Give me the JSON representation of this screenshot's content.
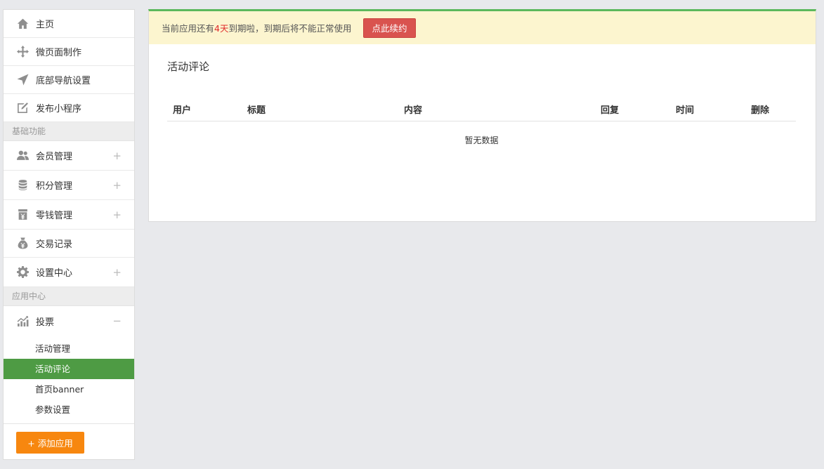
{
  "sidebar": {
    "top_items": [
      {
        "label": "主页",
        "icon": "home-icon"
      },
      {
        "label": "微页面制作",
        "icon": "move-icon"
      },
      {
        "label": "底部导航设置",
        "icon": "navigation-arrow-icon"
      },
      {
        "label": "发布小程序",
        "icon": "edit-icon"
      }
    ],
    "section_basic": "基础功能",
    "basic_items": [
      {
        "label": "会员管理",
        "icon": "users-icon",
        "toggle": "+"
      },
      {
        "label": "积分管理",
        "icon": "database-icon",
        "toggle": "+"
      },
      {
        "label": "零钱管理",
        "icon": "wallet-icon",
        "toggle": "+"
      },
      {
        "label": "交易记录",
        "icon": "money-bag-icon"
      },
      {
        "label": "设置中心",
        "icon": "gear-icon",
        "toggle": "+"
      }
    ],
    "section_apps": "应用中心",
    "app_items": [
      {
        "label": "投票",
        "icon": "bar-chart-icon",
        "toggle": "−"
      }
    ],
    "sub_items": [
      "活动管理",
      "活动评论",
      "首页banner",
      "参数设置"
    ],
    "active_sub": "活动评论",
    "add_button": "+ 添加应用"
  },
  "notice": {
    "prefix": "当前应用还有",
    "days": "4天",
    "suffix": "到期啦，到期后将不能正常使用",
    "renew_button": "点此续约"
  },
  "main": {
    "title": "活动评论",
    "columns": [
      "用户",
      "标题",
      "内容",
      "回复",
      "时间",
      "删除"
    ],
    "empty_text": "暂无数据"
  },
  "colors": {
    "accent_green": "#4e9b44",
    "top_border_green": "#5cb85c",
    "notice_bg": "#fcf5cf",
    "renew_red": "#d9534f",
    "add_orange": "#f7870f"
  }
}
